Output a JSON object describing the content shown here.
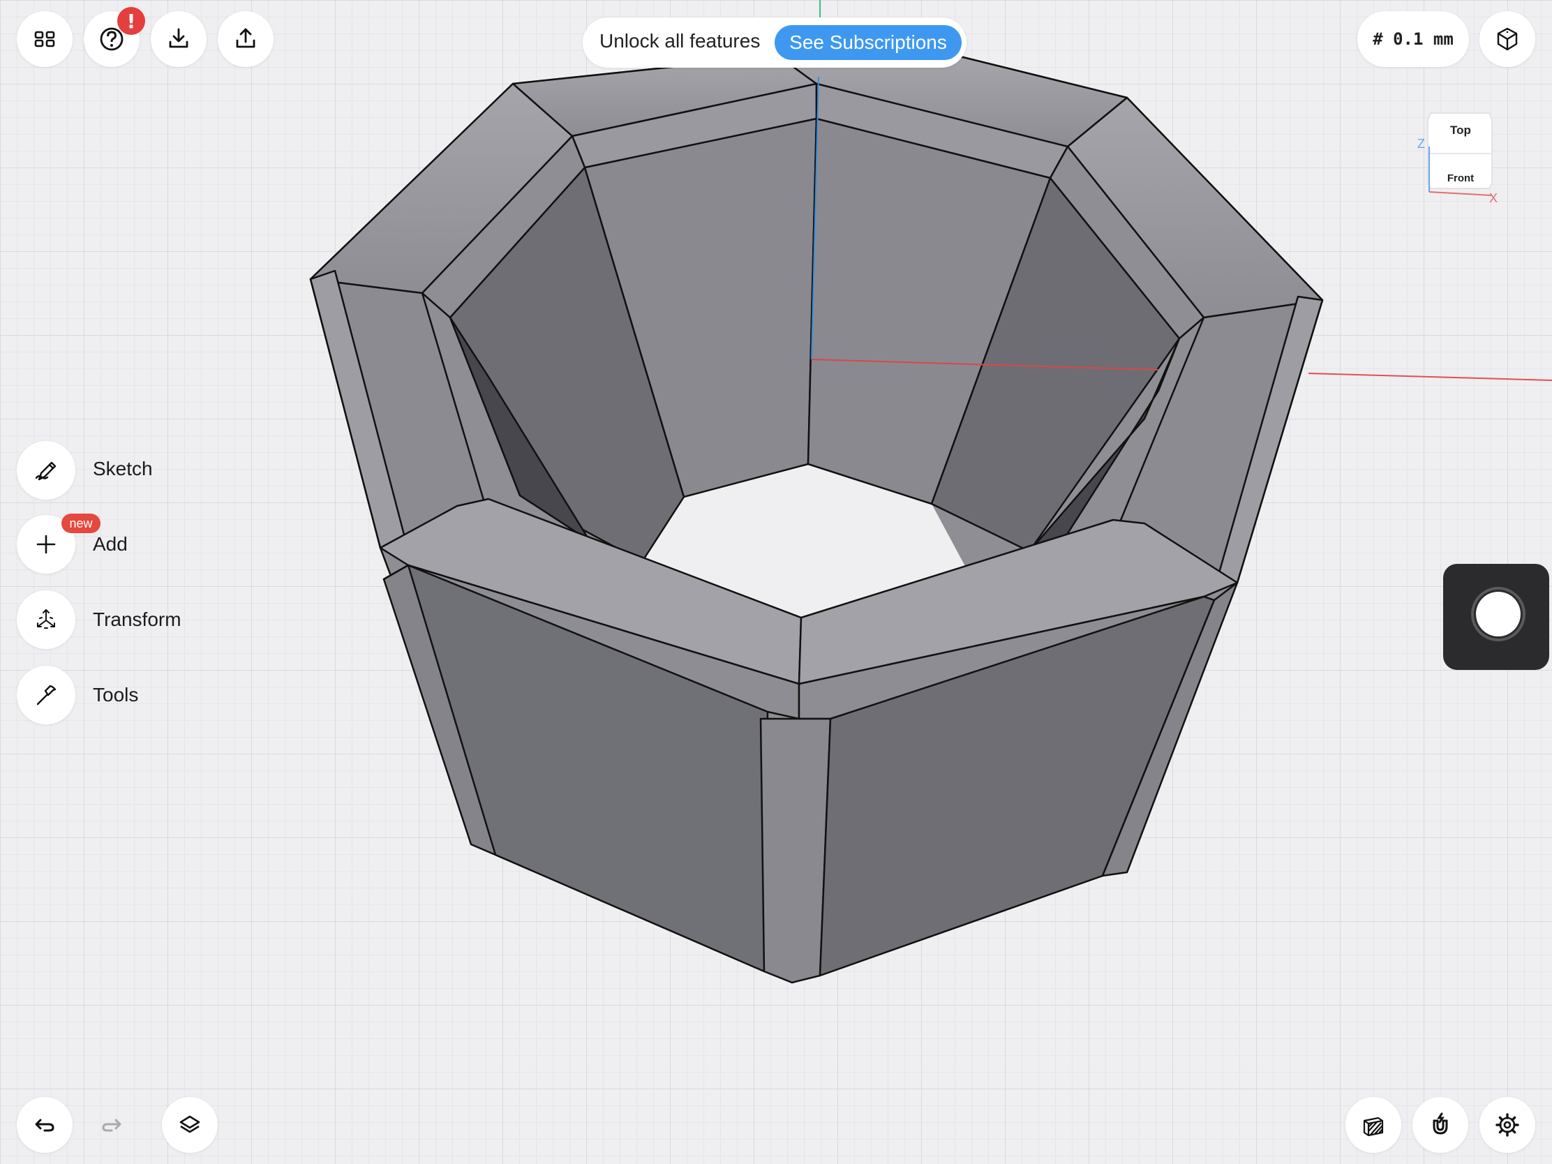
{
  "app": {
    "promo": {
      "text": "Unlock all features",
      "button": "See Subscriptions"
    },
    "grid_size": "# 0.1 mm",
    "alert_badge": "!",
    "menu": [
      {
        "key": "sketch",
        "label": "Sketch",
        "icon": "pencil-icon"
      },
      {
        "key": "add",
        "label": "Add",
        "icon": "plus-icon",
        "badge": "new"
      },
      {
        "key": "transform",
        "label": "Transform",
        "icon": "transform-arrows-icon"
      },
      {
        "key": "tools",
        "label": "Tools",
        "icon": "hammer-icon"
      }
    ],
    "view_cube": {
      "top": "Top",
      "front": "Front",
      "axis_z": "Z",
      "axis_x": "X"
    },
    "colors": {
      "accent": "#3e98f0",
      "alert": "#e53e3e",
      "new_badge": "#e5483d",
      "model": "#7a7980",
      "axis_x": "#e05050",
      "axis_z": "#4aa0e0",
      "axis_y": "#3cc08a"
    }
  }
}
